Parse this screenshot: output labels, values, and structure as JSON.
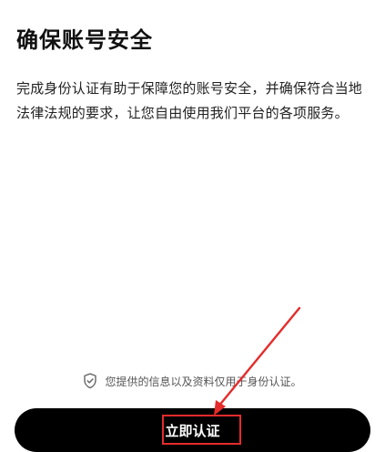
{
  "page": {
    "title": "确保账号安全",
    "description_lines": [
      "完成身份认证有助于保障您的账号安全，并确保符合当地",
      "法律法规的要求，让您自由使用我们平台的各项服务。"
    ],
    "privacy_note": "您提供的信息以及资料仅用于身份认证。",
    "cta_label": "立即认证"
  },
  "icons": {
    "privacy": "shield-check-icon",
    "annotation_arrow": "red-arrow-icon"
  },
  "colors": {
    "background": "#ffffff",
    "text_primary": "#111111",
    "text_secondary": "#555555",
    "button_bg": "#000000",
    "button_text": "#ffffff",
    "annotation": "#e52b2b"
  }
}
